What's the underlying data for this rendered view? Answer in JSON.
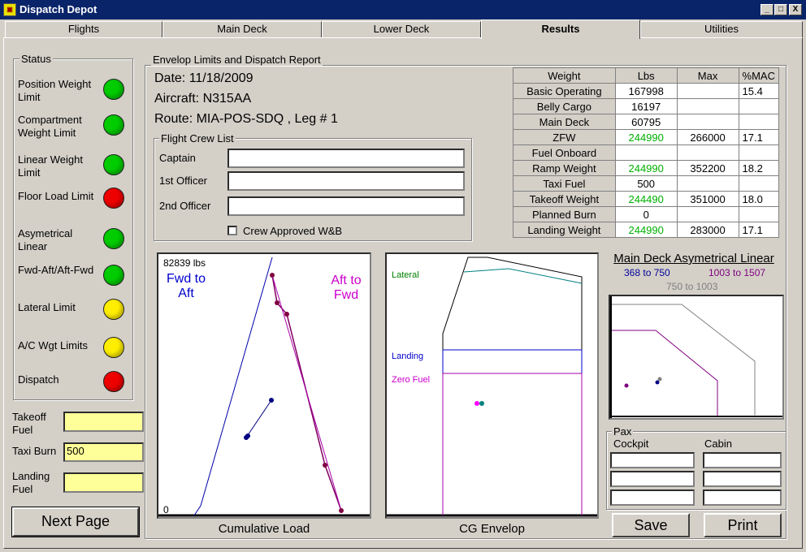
{
  "window": {
    "title": "Dispatch Depot",
    "controls": {
      "min": "_",
      "max": "□",
      "close": "X"
    }
  },
  "tabs": [
    "Flights",
    "Main Deck",
    "Lower Deck",
    "Results",
    "Utilities"
  ],
  "active_tab": "Results",
  "status": {
    "title": "Status",
    "items": [
      {
        "label": "Position Weight Limit",
        "color": "#00cc00"
      },
      {
        "label": "Compartment Weight Limit",
        "color": "#00cc00"
      },
      {
        "label": "Linear Weight Limit",
        "color": "#00cc00"
      },
      {
        "label": "Floor Load Limit",
        "color": "#ee0000"
      },
      {
        "label": "Asymetrical Linear",
        "color": "#00cc00"
      },
      {
        "label": "Fwd-Aft/Aft-Fwd",
        "color": "#00cc00"
      },
      {
        "label": "Lateral Limit",
        "color": "#ffee00"
      },
      {
        "label": "A/C Wgt Limits",
        "color": "#ffee00"
      },
      {
        "label": "Dispatch",
        "color": "#ee0000"
      }
    ]
  },
  "fuel": {
    "takeoff_label": "Takeoff Fuel",
    "takeoff_value": "",
    "taxi_label": "Taxi Burn",
    "taxi_value": "500",
    "landing_label": "Landing Fuel",
    "landing_value": ""
  },
  "next_page_label": "Next Page",
  "report": {
    "title": "Envelop Limits and Dispatch Report",
    "date": "Date: 11/18/2009",
    "aircraft": "Aircraft: N315AA",
    "route": "Route: MIA-POS-SDQ , Leg # 1"
  },
  "crew": {
    "title": "Flight Crew List",
    "captain_label": "Captain",
    "captain_value": "",
    "first_label": "1st Officer",
    "first_value": "",
    "second_label": "2nd Officer",
    "second_value": "",
    "approved_label": "Crew Approved W&B",
    "approved_checked": false
  },
  "weights": {
    "headers": [
      "Weight",
      "Lbs",
      "Max",
      "%MAC"
    ],
    "rows": [
      {
        "name": "Basic Operating",
        "lbs": "167998",
        "max": "",
        "mac": "15.4",
        "green": false
      },
      {
        "name": "Belly Cargo",
        "lbs": "16197",
        "max": "",
        "mac": "",
        "green": false
      },
      {
        "name": "Main Deck",
        "lbs": "60795",
        "max": "",
        "mac": "",
        "green": false
      },
      {
        "name": "ZFW",
        "lbs": "244990",
        "max": "266000",
        "mac": "17.1",
        "green": true
      },
      {
        "name": "Fuel Onboard",
        "lbs": "",
        "max": "",
        "mac": "",
        "green": false
      },
      {
        "name": "Ramp Weight",
        "lbs": "244990",
        "max": "352200",
        "mac": "18.2",
        "green": true
      },
      {
        "name": "Taxi Fuel",
        "lbs": "500",
        "max": "",
        "mac": "",
        "green": false
      },
      {
        "name": "Takeoff Weight",
        "lbs": "244490",
        "max": "351000",
        "mac": "18.0",
        "green": true
      },
      {
        "name": "Planned Burn",
        "lbs": "0",
        "max": "",
        "mac": "",
        "green": false
      },
      {
        "name": "Landing Weight",
        "lbs": "244990",
        "max": "283000",
        "mac": "17.1",
        "green": true
      }
    ]
  },
  "cumulative": {
    "caption": "Cumulative Load",
    "top_value": "82839 lbs",
    "zero": "0",
    "fwd_label": "Fwd to Aft",
    "aft_label": "Aft to Fwd",
    "fwd_color": "#0000cc",
    "aft_color": "#cc00cc"
  },
  "cg": {
    "caption": "CG Envelop",
    "lateral": "Lateral",
    "landing": "Landing",
    "zero_fuel": "Zero Fuel",
    "lateral_color": "#008000",
    "landing_color": "#0000cc",
    "zero_fuel_color": "#cc00cc"
  },
  "asym": {
    "title": "Main Deck Asymetrical Linear",
    "range1": "368 to 750",
    "range2": "1003 to 1507",
    "range3": "750 to 1003",
    "range1_color": "#000099",
    "range2_color": "#800080",
    "range3_color": "#808080"
  },
  "pax": {
    "title": "Pax",
    "cockpit": "Cockpit",
    "cabin": "Cabin"
  },
  "buttons": {
    "save": "Save",
    "print": "Print"
  }
}
